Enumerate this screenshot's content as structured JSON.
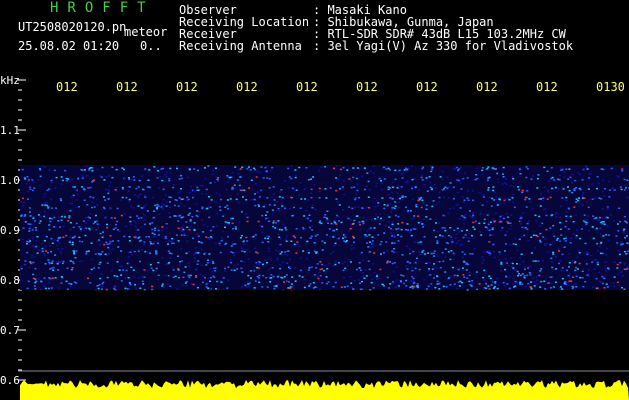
{
  "header": {
    "program": "HROFFT",
    "filename": "UT2508020120.pn",
    "mode": "meteor",
    "datetime": "25.08.02 01:20",
    "status": "0.."
  },
  "info": [
    {
      "label": "Observer",
      "value": ": Masaki Kano"
    },
    {
      "label": "Receiving Location",
      "value": ": Shibukawa, Gunma, Japan"
    },
    {
      "label": "Receiver",
      "value": ": RTL-SDR SDR# 43dB L15 103.2MHz CW"
    },
    {
      "label": "Receiving Antenna",
      "value": ": 3el Yagi(V) Az 330 for Vladivostok"
    }
  ],
  "axis": {
    "y_unit": "kHz",
    "y_ticks": [
      "1.1",
      "1.0",
      "0.9",
      "0.8",
      "0.7",
      "0.6"
    ],
    "x_ticks": [
      "012",
      "012",
      "012",
      "012",
      "012",
      "012",
      "012",
      "012",
      "012",
      "0130"
    ]
  },
  "colors": {
    "background": "#000000",
    "title": "#3fd23f",
    "time_labels": "#ffff66",
    "noise_band": "#ffff00",
    "waterfall_low": "#1010a0",
    "waterfall_mid": "#20c0ff",
    "waterfall_high": "#ff3030"
  }
}
